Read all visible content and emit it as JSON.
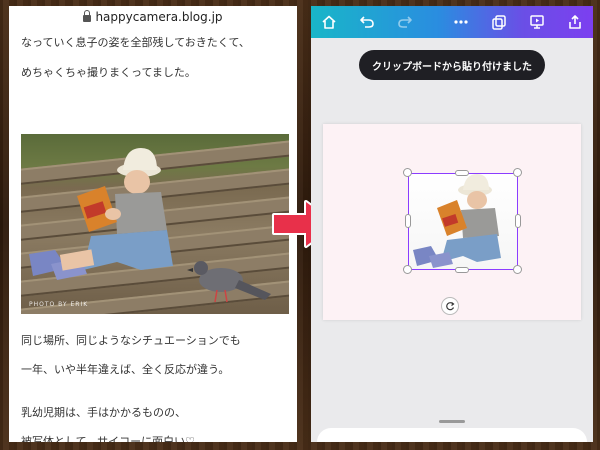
{
  "browser": {
    "url": "happycamera.blog.jp"
  },
  "blog": {
    "lines_top": [
      "なっていく息子の姿を全部残しておきたくて、",
      "めちゃくちゃ撮りまくってました。"
    ],
    "photo_watermark": "PHOTO BY ERIK",
    "lines_bottom": [
      "同じ場所、同じようなシチュエーションでも",
      "一年、いや半年違えば、全く反応が違う。",
      "乳幼児期は、手はかかるものの、",
      "被写体として、サイコーに面白い♡"
    ]
  },
  "editor": {
    "toolbar_icons": [
      "home-icon",
      "undo-icon",
      "redo-icon",
      "more-icon",
      "layers-icon",
      "present-icon",
      "share-icon"
    ],
    "toast": "クリップボードから貼り付けました"
  },
  "colors": {
    "arrow": "#e8304a",
    "selection": "#8b3dff",
    "toast_bg": "#1f1f24"
  }
}
